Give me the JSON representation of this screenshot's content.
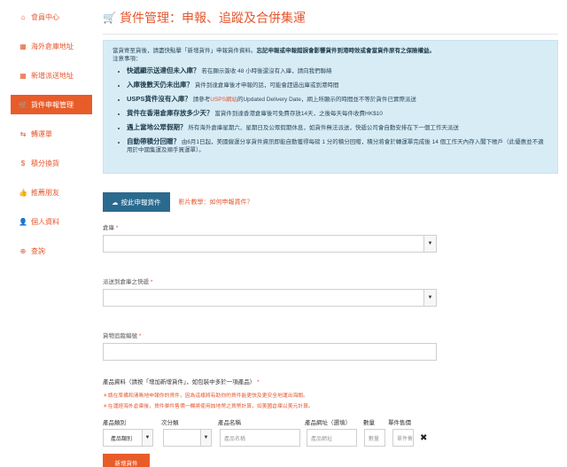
{
  "sidebar": {
    "items": [
      {
        "label": "會員中心",
        "icon": "home-icon",
        "glyph": "⌂",
        "active": false
      },
      {
        "label": "海外倉庫地址",
        "icon": "warehouse-icon",
        "glyph": "▦",
        "active": false
      },
      {
        "label": "新增派送地址",
        "icon": "warehouse-icon",
        "glyph": "▦",
        "active": false
      },
      {
        "label": "貨件申報管理",
        "icon": "cart-icon",
        "glyph": "🛒",
        "active": true
      },
      {
        "label": "轉運單",
        "icon": "exchange-icon",
        "glyph": "⇆",
        "active": false
      },
      {
        "label": "積分換貨",
        "icon": "dollar-icon",
        "glyph": "$",
        "active": false
      },
      {
        "label": "推薦朋友",
        "icon": "thumbs-up-icon",
        "glyph": "👍",
        "active": false
      },
      {
        "label": "個人資料",
        "icon": "user-icon",
        "glyph": "👤",
        "active": false
      },
      {
        "label": "查詢",
        "icon": "globe-icon",
        "glyph": "⊕",
        "active": false
      }
    ]
  },
  "page": {
    "title": "貨件管理：申報、追蹤及合併集運",
    "title_icon": "🛒"
  },
  "notice": {
    "intro_plain": "當貨寄至貨後，請盡快點擊「新增貨件」申報貨件資料。",
    "intro_strong": "忘記申報或申報錯誤會影響貨件到港時效或會當貨件原有之保險權益。",
    "intro_tail": "注意事項：",
    "items": [
      {
        "strong": "快遞顯示送達但未入庫？",
        "text": "若在顯示簽收 48 小時後還沒有入庫，請向我們聯絡"
      },
      {
        "strong": "入庫後數天仍未出庫？",
        "text": "貨件到達倉庫後才申報的話，可能會趕過出庫或到港時間"
      },
      {
        "strong": "USPS貨件沒有入庫？",
        "text_a": "請參考",
        "link": "USPS網站",
        "text_b": "的Updated Delivery Date，網上所顯示的時間並不等於貨件已實際派送"
      },
      {
        "strong": "貨件在香港倉庫存放多少天？",
        "text": "當貨件到達香港倉庫後可免費存放14天，之後每天每件收費HK$10"
      },
      {
        "strong": "遇上當地公眾假期？",
        "text": "所有海外倉庫星期六、星期日及公眾假期休息，如貨件無法派送，快遞公司會自動安排在下一個工作天派送"
      },
      {
        "strong": "自動帶積分回贈？",
        "text": "由6月1日起，美國僱運分享貨件資訊即能自動獲得每磅 1 分的積分回贈，積分將會於轉運單完成後 14 個工作天內存入閣下帳戶（此優惠並不適用於中國集運及順手買運單）。"
      }
    ]
  },
  "actions": {
    "add_declare_label": "按此申報貨件",
    "add_declare_icon": "upload-icon",
    "help_link": "影片教學：如何申報貨件？"
  },
  "form": {
    "warehouse_label": "倉庫",
    "courier_label": "派送到倉庫之快遞",
    "tracking_label": "貨物追蹤編號",
    "required_mark": "*",
    "products_label": "產品資料（請按「增加新增貨件」，如包裝中多於一項產品）",
    "notes": [
      "＊請在準備和清晰地申報你的貨件，因為這樣將有助你的貨件能更快及更安全地運出海關。",
      "＊在運經海外倉庫後，貨件單件售價一欄將使用該地幣之貨幣計算，如美國倉庫以美元計算。"
    ]
  },
  "product_table": {
    "headers": [
      "產品類別",
      "次分類",
      "產品名稱",
      "產品網址（選填）",
      "數量",
      "單件售價"
    ],
    "row": {
      "category_value": "產品類別",
      "subcategory_value": "",
      "name_placeholder": "產品名稱",
      "url_placeholder": "產品網址",
      "qty_placeholder": "數量",
      "price_placeholder": "單件售價",
      "delete_glyph": "✖"
    },
    "add_button": "新增貨件"
  },
  "colors": {
    "accent": "#e85c2a",
    "primary_button": "#2a6a8f",
    "notice_bg": "#d8ecf6"
  }
}
